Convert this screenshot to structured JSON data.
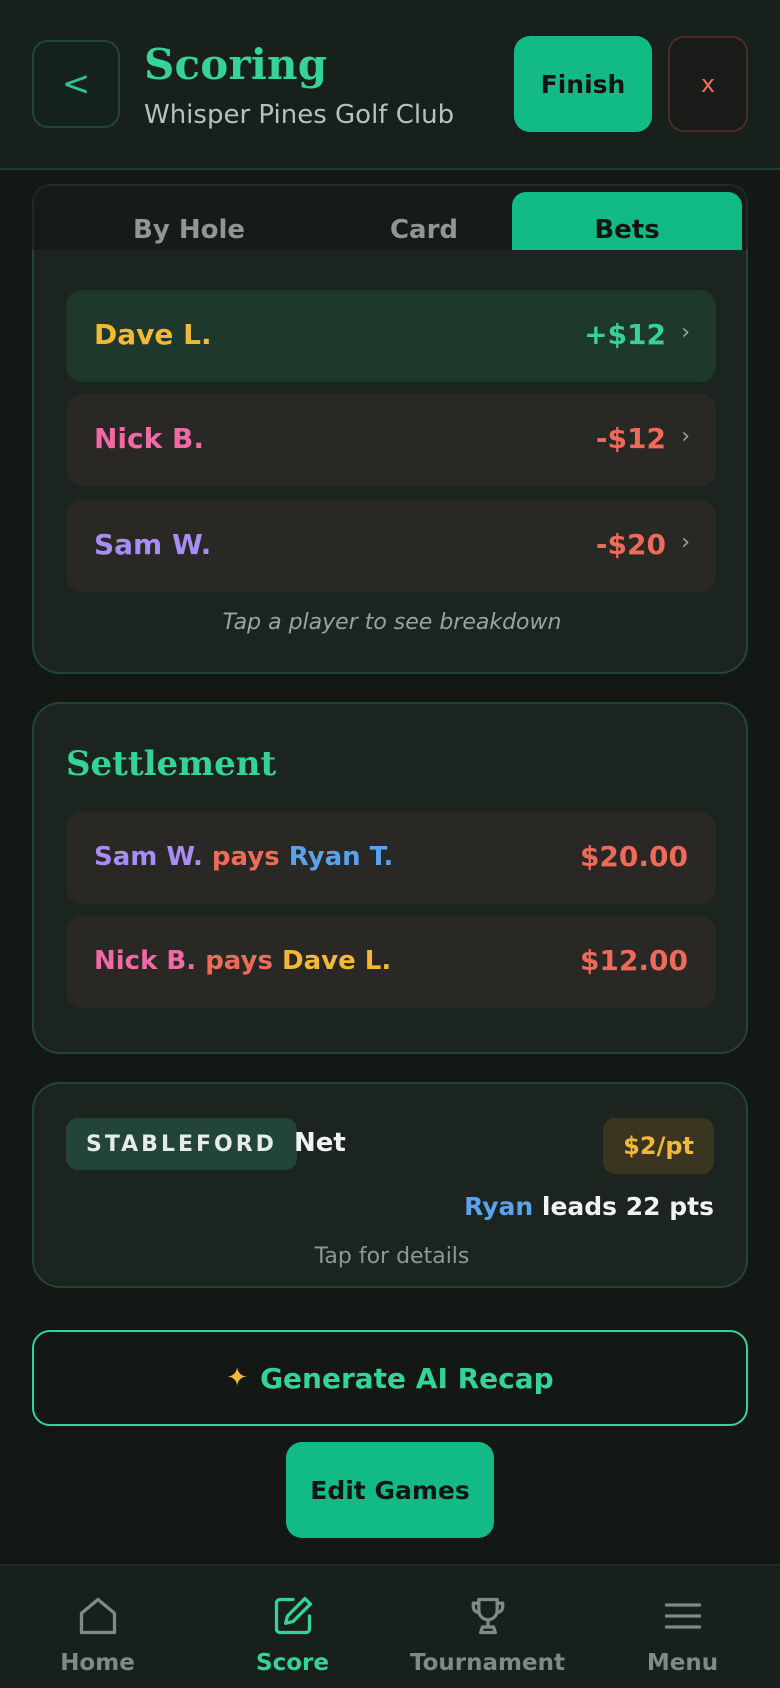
{
  "header": {
    "title": "Scoring",
    "subtitle": "Whisper Pines Golf Club",
    "back_glyph": "<",
    "finish_label": "Finish",
    "close_glyph": "x"
  },
  "tabs": [
    {
      "label": "By Hole",
      "active": false
    },
    {
      "label": "Card",
      "active": false
    },
    {
      "label": "Bets",
      "active": true
    }
  ],
  "standings": {
    "rows": [
      {
        "name": "Dave L.",
        "amount": "+$12",
        "name_color": "#f2b937",
        "amount_color": "#35d39a"
      },
      {
        "name": "Nick B.",
        "amount": "-$12",
        "name_color": "#f06aa6",
        "amount_color": "#f06a5a"
      },
      {
        "name": "Sam W.",
        "amount": "-$20",
        "name_color": "#a98cf5",
        "amount_color": "#f06a5a"
      }
    ],
    "hint": "Tap a player to see breakdown"
  },
  "settlement": {
    "title": "Settlement",
    "rows": [
      {
        "payer": "Sam W.",
        "verb": "pays",
        "payee": "Ryan T.",
        "amount": "$20.00"
      },
      {
        "payer": "Nick B.",
        "verb": "pays",
        "payee": "Dave L.",
        "amount": "$12.00"
      }
    ]
  },
  "stableford": {
    "badge": "STABLEFORD",
    "mode": "Net",
    "rate": "$2/pt",
    "leader": "Ryan",
    "leads_text": "leads 22 pts",
    "tap_hint": "Tap for details"
  },
  "recap": {
    "icon": "✦",
    "label": "Generate AI Recap"
  },
  "edit_games": {
    "label": "Edit Games"
  },
  "nav": [
    {
      "label": "Home",
      "icon": "home-icon",
      "active": false
    },
    {
      "label": "Score",
      "icon": "edit-icon",
      "active": true
    },
    {
      "label": "Tournament",
      "icon": "trophy-icon",
      "active": false
    },
    {
      "label": "Menu",
      "icon": "menu-icon",
      "active": false
    }
  ],
  "colors": {
    "accent": "#12bb85",
    "accent_text": "#35d39a",
    "ryan": "#5aa2ee",
    "dave": "#f2b937",
    "nick": "#f06aa6",
    "sam": "#a98cf5",
    "negative": "#f06a5a"
  }
}
